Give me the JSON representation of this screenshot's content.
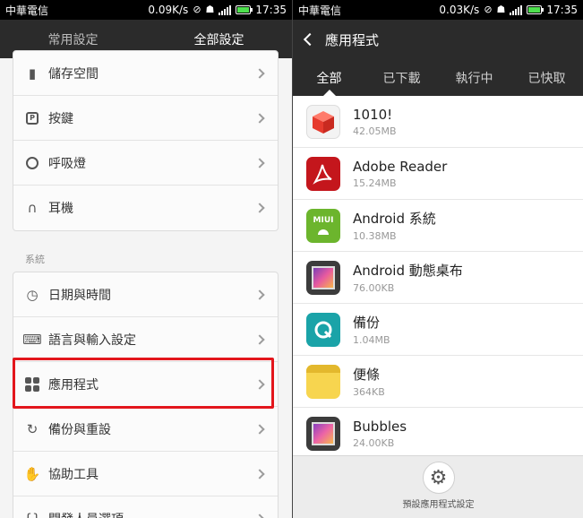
{
  "left": {
    "status": {
      "carrier": "中華電信",
      "speed": "0.09K/s",
      "time": "17:35"
    },
    "tabs": [
      {
        "label": "常用設定"
      },
      {
        "label": "全部設定"
      }
    ],
    "group1": [
      {
        "label": "儲存空間",
        "icon": "sd-card-icon"
      },
      {
        "label": "按鍵",
        "icon": "key-icon"
      },
      {
        "label": "呼吸燈",
        "icon": "light-icon"
      },
      {
        "label": "耳機",
        "icon": "headphones-icon"
      }
    ],
    "section_label": "系統",
    "group2": [
      {
        "label": "日期與時間",
        "icon": "clock-icon"
      },
      {
        "label": "語言與輸入設定",
        "icon": "keyboard-icon"
      },
      {
        "label": "應用程式",
        "icon": "apps-icon"
      },
      {
        "label": "備份與重設",
        "icon": "backup-icon"
      },
      {
        "label": "協助工具",
        "icon": "hand-icon"
      },
      {
        "label": "開發人員選項",
        "icon": "braces-icon"
      }
    ],
    "highlight_color": "#e3161c"
  },
  "right": {
    "status": {
      "carrier": "中華電信",
      "speed": "0.03K/s",
      "time": "17:35"
    },
    "title": "應用程式",
    "subtabs": [
      {
        "label": "全部"
      },
      {
        "label": "已下載"
      },
      {
        "label": "執行中"
      },
      {
        "label": "已快取"
      }
    ],
    "apps": [
      {
        "name": "1010!",
        "size": "42.05MB",
        "icon": "cube-icon"
      },
      {
        "name": "Adobe Reader",
        "size": "15.24MB",
        "icon": "adobe-reader-icon"
      },
      {
        "name": "Android 系統",
        "size": "10.38MB",
        "icon": "miui-android-icon"
      },
      {
        "name": "Android 動態桌布",
        "size": "76.00KB",
        "icon": "wallpaper-icon"
      },
      {
        "name": "備份",
        "size": "1.04MB",
        "icon": "backup-app-icon"
      },
      {
        "name": "便條",
        "size": "364KB",
        "icon": "notes-icon"
      },
      {
        "name": "Bubbles",
        "size": "24.00KB",
        "icon": "bubbles-icon"
      }
    ],
    "bottom_label": "預設應用程式設定"
  }
}
